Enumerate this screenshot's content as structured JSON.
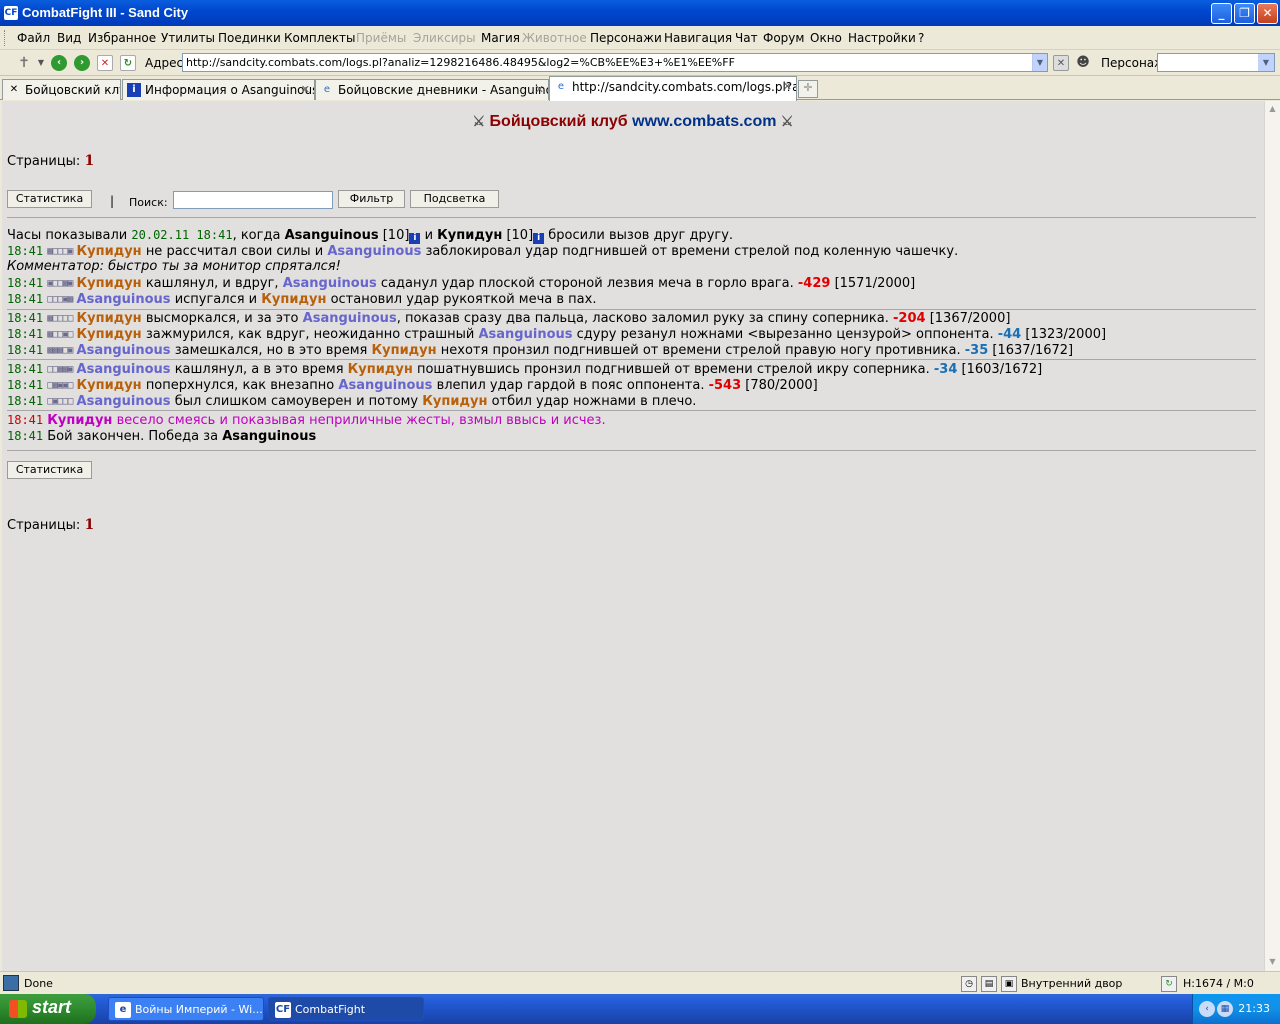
{
  "window": {
    "title": "CombatFight III - Sand City",
    "minimize": "_",
    "maximize": "❐",
    "close": "✕"
  },
  "menu": {
    "items": [
      {
        "label": "Файл",
        "disabled": false
      },
      {
        "label": "Вид",
        "disabled": false
      },
      {
        "label": "Избранное",
        "disabled": false
      },
      {
        "label": "Утилиты",
        "disabled": false
      },
      {
        "label": "Поединки",
        "disabled": false
      },
      {
        "label": "Комплекты",
        "disabled": false
      },
      {
        "label": "Приёмы",
        "disabled": true
      },
      {
        "label": "Эликсиры",
        "disabled": true
      },
      {
        "label": "Магия",
        "disabled": false
      },
      {
        "label": "Животное",
        "disabled": true
      },
      {
        "label": "Персонажи",
        "disabled": false
      },
      {
        "label": "Навигация",
        "disabled": false
      },
      {
        "label": "Чат",
        "disabled": false
      },
      {
        "label": "Форум",
        "disabled": false
      },
      {
        "label": "Окно",
        "disabled": false
      },
      {
        "label": "Настройки",
        "disabled": false
      },
      {
        "label": "?",
        "disabled": false
      }
    ]
  },
  "address": {
    "label": "Адрес:",
    "url": "http://sandcity.combats.com/logs.pl?analiz=1298216486.48495&log2=%CB%EE%E3+%E1%EE%FF",
    "character_label": "Персонаж:"
  },
  "tabs": [
    {
      "label": "Бойцовский клуб",
      "icon": "crossed-swords-icon",
      "active": false
    },
    {
      "label": "Информация о Asanguinous",
      "icon": "info-icon",
      "active": false
    },
    {
      "label": "Бойцовские дневники - Asanguinous",
      "icon": "ie-icon",
      "active": false
    },
    {
      "label": "http://sandcity.combats.com/logs.pl?a...",
      "icon": "ie-icon",
      "active": true
    }
  ],
  "page": {
    "banner_part1": "Бойцовский клуб",
    "banner_part2": "www.combats.com",
    "pages_label": "Страницы:",
    "pages_value": "1",
    "stats_button": "Статистика",
    "separator": "|",
    "search_label": "Поиск:",
    "filter_button": "Фильтр",
    "highlight_button": "Подсветка"
  },
  "log": {
    "intro_prefix": "Часы показывали",
    "intro_datetime": "20.02.11 18:41",
    "intro_when": ", когда",
    "fighter1": "Asanguinous",
    "fighter1_level": "[10]",
    "intro_and": "и",
    "fighter2": "Купидун",
    "fighter2_level": "[10]",
    "intro_suffix": "бросили вызов друг другу.",
    "time": "18:41",
    "l1_t1": "не рассчитал свои силы и",
    "l1_t2": "заблокировал удар подгнившей от времени стрелой под коленную чашечку.",
    "comment": "Комментатор: быстро ты за монитор спрятался!",
    "l2_t1": "кашлянул, и вдруг,",
    "l2_t2": "саданул удар плоской стороной лезвия меча в горло врага.",
    "l2_dmg": "-429",
    "l2_hp": "[1571/2000]",
    "l3_t1": "испугался и",
    "l3_t2": "остановил удар рукояткой меча в пах.",
    "l4_t1": "высморкался, и за это",
    "l4_t2": ", показав сразу два пальца, ласково заломил руку за спину соперника.",
    "l4_dmg": "-204",
    "l4_hp": "[1367/2000]",
    "l5_t1": "зажмурился, как вдруг, неожиданно страшный",
    "l5_t2": "сдуру резанул ножнами <вырезанно цензурой> оппонента.",
    "l5_dmg": "-44",
    "l5_hp": "[1323/2000]",
    "l6_t1": "замешкался, но в это время",
    "l6_t2": "нехотя пронзил подгнившей от времени стрелой правую ногу противника.",
    "l6_dmg": "-35",
    "l6_hp": "[1637/1672]",
    "l7_t1": "кашлянул, а в это время",
    "l7_t2": "пошатнувшись пронзил подгнившей от времени стрелой икру соперника.",
    "l7_dmg": "-34",
    "l7_hp": "[1603/1672]",
    "l8_t1": "поперхнулся, как внезапно",
    "l8_t2": "влепил удар гардой в пояс оппонента.",
    "l8_dmg": "-543",
    "l8_hp": "[780/2000]",
    "l9_t1": "был слишком самоуверен и потому",
    "l9_t2": "отбил удар ножнами в плечо.",
    "l10_t1": "весело смеясь и показывая неприличные жесты, взмыл ввысь и исчез.",
    "end_text": "Бой закончен. Победа за",
    "winner": "Asanguinous"
  },
  "status": {
    "text": "Done",
    "location": "Внутренний двор",
    "hp": "H:1674 / M:0"
  },
  "taskbar": {
    "start": "start",
    "tasks": [
      {
        "label": "Войны Империй - Wi...",
        "active": false
      },
      {
        "label": "CombatFight",
        "active": true
      }
    ],
    "clock": "21:33"
  },
  "colors": {
    "kupidun": "#b8610a",
    "asanguinous": "#6666cc",
    "damage_red": "#e00000",
    "damage_blue": "#1a6fb5",
    "time_green": "#006400"
  }
}
